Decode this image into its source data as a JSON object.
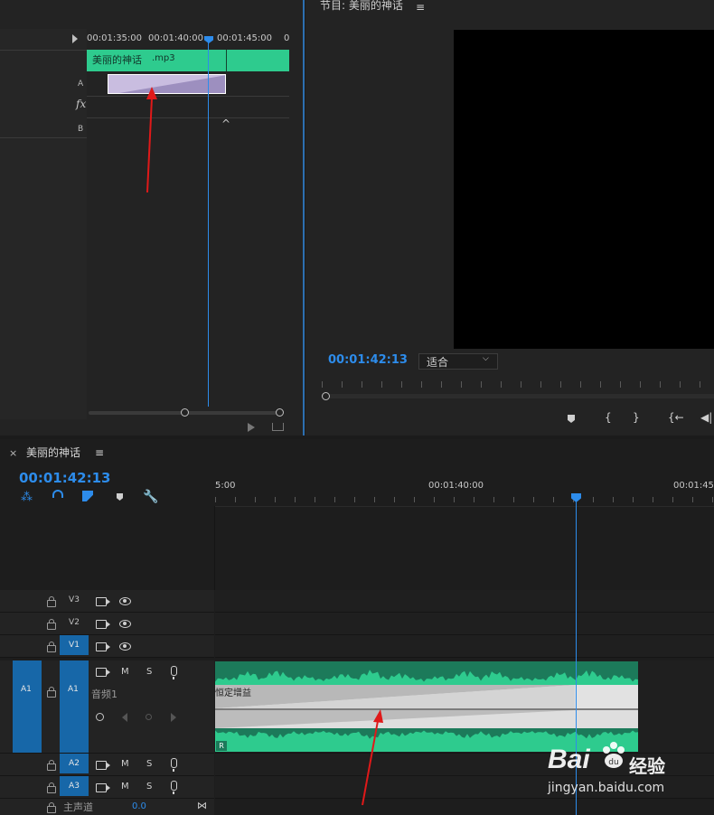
{
  "source_panel": {
    "ruler_labels": [
      "00:01:35:00",
      "00:01:40:00",
      "00:01:45:00",
      "0"
    ],
    "clip_name": "美丽的神话",
    "clip_ext": ".mp3",
    "row_label_a": "A",
    "row_label_b": "B",
    "fx_label": "fx",
    "up_chevron": "^"
  },
  "program_monitor": {
    "title": "节目: 美丽的神话",
    "timecode": "00:01:42:13",
    "fit_select": "适合",
    "buttons": [
      "marker",
      "mark-in",
      "mark-out",
      "go-to-in",
      "step-back"
    ]
  },
  "timeline": {
    "close": "×",
    "sequence_name": "美丽的神话",
    "timecode": "00:01:42:13",
    "ruler_labels": [
      "5:00",
      "00:01:40:00",
      "00:01:45:"
    ],
    "tracks": {
      "v3": "V3",
      "v2": "V2",
      "v1": "V1",
      "a1_source": "A1",
      "a1": "A1",
      "a1_name": "音频1",
      "a2": "A2",
      "a3": "A3",
      "master": "主声道",
      "master_value": "0.0"
    },
    "mute": "M",
    "solo": "S",
    "clip_effect_label": "恒定增益",
    "clip_channel_label": "R"
  },
  "watermark": {
    "brand": "Bai",
    "brand_cn": "经验",
    "url": "jingyan.baidu.com"
  },
  "colors": {
    "accent_blue": "#2d8ceb",
    "audio_clip_green": "#2ecb8e",
    "audio_clip_dark_green": "#1c7a5a",
    "transition_purple": "#c9bde0",
    "annotation_arrow": "#e01919"
  }
}
